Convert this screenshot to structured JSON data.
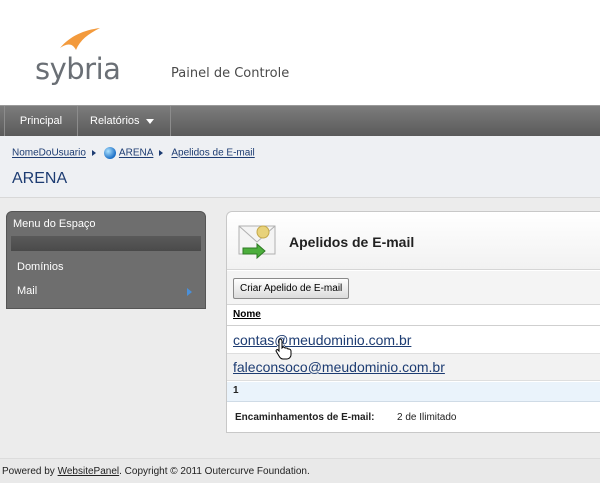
{
  "header": {
    "logo_text": "sybria",
    "panel_title": "Painel de Controle"
  },
  "nav": {
    "items": [
      {
        "label": "Principal"
      },
      {
        "label": "Relatórios"
      }
    ]
  },
  "breadcrumb": {
    "items": [
      "NomeDoUsuario",
      "ARENA",
      "Apelidos de E-mail"
    ]
  },
  "page_title": "ARENA",
  "sidebar": {
    "title": "Menu do Espaço",
    "items": [
      {
        "label": "Domínios"
      },
      {
        "label": "Mail"
      }
    ]
  },
  "content": {
    "title": "Apelidos de E-mail",
    "create_button": "Criar Apelido de E-mail",
    "column_header": "Nome",
    "rows": [
      "contas@meudominio.com.br",
      "faleconsoco@meudominio.com.br"
    ],
    "pager_page": "1",
    "quota_label": "Encaminhamentos de E-mail:",
    "quota_value": "2 de Ilimitado"
  },
  "footer": {
    "prefix": "Powered by ",
    "link": "WebsitePanel",
    "suffix": ". Copyright © 2011 Outercurve Foundation."
  },
  "colors": {
    "link": "#1d3c72",
    "nav_bg": "#6a6a6a",
    "side_bg": "#6e6e6e",
    "logo_accent": "#f39a3c"
  }
}
